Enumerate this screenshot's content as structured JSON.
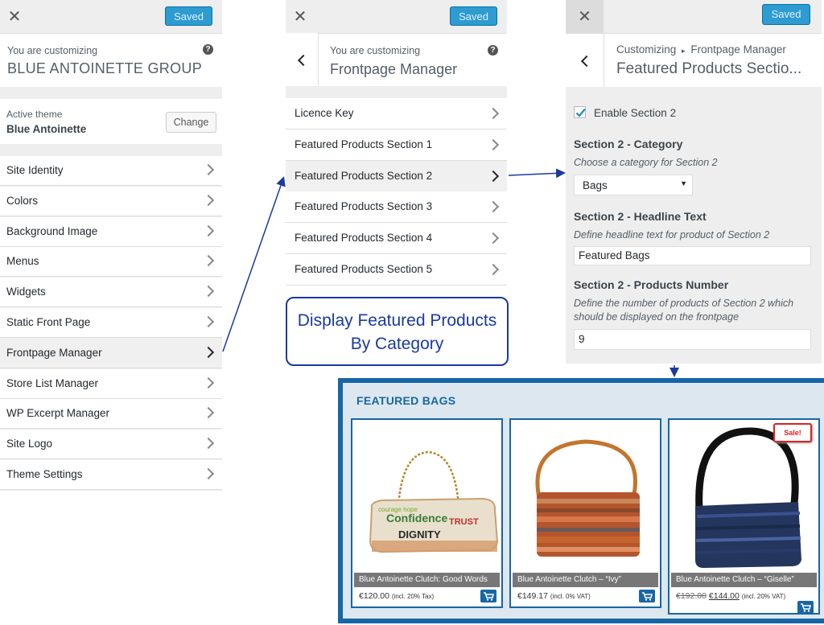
{
  "panel1": {
    "close_icon": "close-icon",
    "saved_label": "Saved",
    "customizing_label": "You are customizing",
    "site_name": "BLUE ANTOINETTE GROUP",
    "active_theme_label": "Active theme",
    "active_theme_name": "Blue Antoinette",
    "change_label": "Change",
    "menu": [
      {
        "label": "Site Identity"
      },
      {
        "label": "Colors"
      },
      {
        "label": "Background Image"
      },
      {
        "label": "Menus"
      },
      {
        "label": "Widgets"
      },
      {
        "label": "Static Front Page"
      },
      {
        "label": "Frontpage Manager"
      },
      {
        "label": "Store List Manager"
      },
      {
        "label": "WP Excerpt Manager"
      },
      {
        "label": "Site Logo"
      },
      {
        "label": "Theme Settings"
      }
    ]
  },
  "panel2": {
    "saved_label": "Saved",
    "customizing_label": "You are customizing",
    "section_title": "Frontpage Manager",
    "items": [
      {
        "label": "Licence Key"
      },
      {
        "label": "Featured Products Section 1"
      },
      {
        "label": "Featured Products Section 2"
      },
      {
        "label": "Featured Products Section 3"
      },
      {
        "label": "Featured Products Section 4"
      },
      {
        "label": "Featured Products Section 5"
      }
    ]
  },
  "panel3": {
    "saved_label": "Saved",
    "breadcrumb_root": "Customizing",
    "breadcrumb_sep": "▸",
    "breadcrumb_parent": "Frontpage Manager",
    "section_title": "Featured Products Sectio...",
    "enable_label": "Enable Section 2",
    "category_title": "Section 2 - Category",
    "category_desc": "Choose a category for Section 2",
    "category_value": "Bags",
    "headline_title": "Section 2 - Headline Text",
    "headline_desc": "Define headline text for product of Section 2",
    "headline_value": "Featured Bags",
    "number_title": "Section 2 - Products Number",
    "number_desc": "Define the number of products of Section 2 which should be displayed on the frontpage",
    "number_value": "9"
  },
  "callout": {
    "line1": "Display Featured Products",
    "line2": "By Category"
  },
  "shop": {
    "title": "FEATURED BAGS",
    "products": [
      {
        "name": "Blue Antoinette Clutch: Good Words",
        "price": "€120.00",
        "tax": "(incl. 20% Tax)",
        "old_price": "",
        "sale": ""
      },
      {
        "name": "Blue Antoinette Clutch – “Ivy”",
        "price": "€149.17",
        "tax": "(incl. 0% VAT)",
        "old_price": "",
        "sale": ""
      },
      {
        "name": "Blue Antoinette Clutch – “Giselle”",
        "price": "€144.00",
        "tax": "(incl. 20% VAT)",
        "old_price": "€192.00",
        "sale": "Sale!"
      }
    ]
  },
  "colors": {
    "accent": "#2e9bd1",
    "shop_blue": "#1766a6",
    "annotation_blue": "#1a3a9e",
    "sale_red": "#e02020"
  }
}
